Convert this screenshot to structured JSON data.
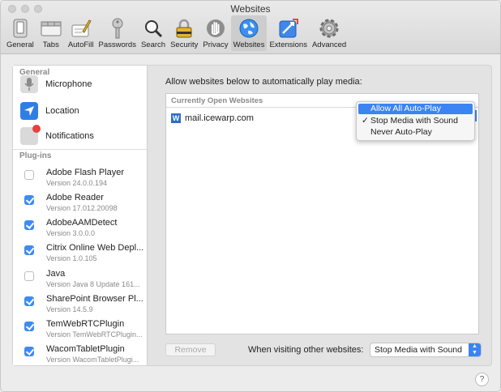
{
  "window": {
    "title": "Websites"
  },
  "toolbar": [
    {
      "label": "General",
      "icon": "general-icon"
    },
    {
      "label": "Tabs",
      "icon": "tabs-icon"
    },
    {
      "label": "AutoFill",
      "icon": "autofill-icon"
    },
    {
      "label": "Passwords",
      "icon": "key-icon"
    },
    {
      "label": "Search",
      "icon": "search-icon"
    },
    {
      "label": "Security",
      "icon": "lock-icon"
    },
    {
      "label": "Privacy",
      "icon": "hand-icon"
    },
    {
      "label": "Websites",
      "icon": "globe-icon",
      "active": true
    },
    {
      "label": "Extensions",
      "icon": "puzzle-icon"
    },
    {
      "label": "Advanced",
      "icon": "gear-icon"
    }
  ],
  "sidebar": {
    "general_header": "General",
    "general_items": [
      {
        "label": "Microphone",
        "icon": "microphone-icon"
      },
      {
        "label": "Location",
        "icon": "location-arrow-icon"
      },
      {
        "label": "Notifications",
        "icon": "notifications-icon"
      }
    ],
    "plugins_header": "Plug-ins",
    "plugins": [
      {
        "name": "Adobe Flash Player",
        "version": "Version 24.0.0.194",
        "checked": false
      },
      {
        "name": "Adobe Reader",
        "version": "Version 17.012.20098",
        "checked": true
      },
      {
        "name": "AdobeAAMDetect",
        "version": "Version 3.0.0.0",
        "checked": true
      },
      {
        "name": "Citrix Online Web Depl...",
        "version": "Version 1.0.105",
        "checked": true
      },
      {
        "name": "Java",
        "version": "Version Java 8 Update 161...",
        "checked": false
      },
      {
        "name": "SharePoint Browser Pl...",
        "version": "Version 14.5.9",
        "checked": true
      },
      {
        "name": "TemWebRTCPlugin",
        "version": "Version TemWebRTCPlugin...",
        "checked": true
      },
      {
        "name": "WacomTabletPlugin",
        "version": "Version WacomTabletPlugi...",
        "checked": true
      }
    ]
  },
  "main": {
    "description": "Allow websites below to automatically play media:",
    "table_header": "Currently Open Websites",
    "site": "mail.icewarp.com",
    "popup_options": [
      {
        "label": "Allow All Auto-Play",
        "highlighted": true,
        "checked": false
      },
      {
        "label": "Stop Media with Sound",
        "highlighted": false,
        "checked": true
      },
      {
        "label": "Never Auto-Play",
        "highlighted": false,
        "checked": false
      }
    ],
    "checkmark": "✓",
    "remove_label": "Remove",
    "other_label": "When visiting other websites:",
    "other_value": "Stop Media with Sound"
  },
  "help_label": "?",
  "colors": {
    "accent": "#3b84f1",
    "checkbox_on": "#3d8bf3"
  }
}
